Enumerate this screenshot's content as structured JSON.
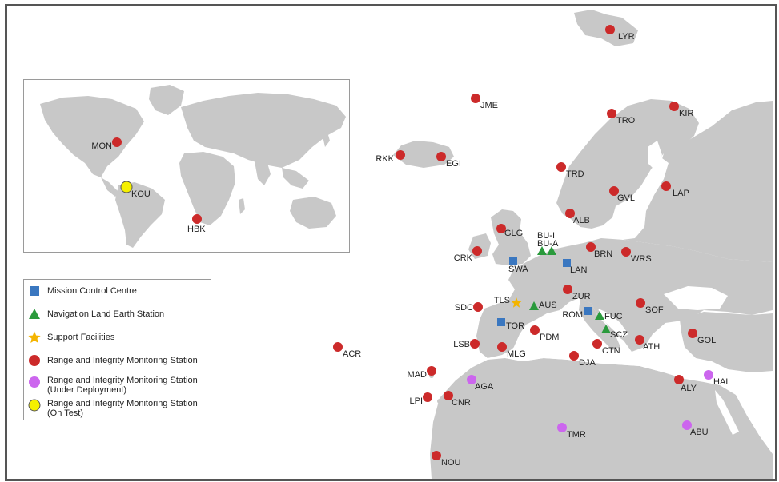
{
  "colors": {
    "land": "#c8c8c8",
    "sea": "#ffffff",
    "frame": "#555555",
    "mcc": "#3a77c0",
    "nles": "#2a9a3c",
    "support": "#f4b400",
    "rims": "#cc2a2a",
    "rims_deploy": "#cc66ee",
    "rims_test": "#f5f000"
  },
  "legend": [
    {
      "id": "mcc",
      "label": "Mission Control Centre",
      "symbol": "square",
      "color": "#3a77c0"
    },
    {
      "id": "nles",
      "label": "Navigation Land Earth Station",
      "symbol": "triangle",
      "color": "#2a9a3c"
    },
    {
      "id": "support",
      "label": "Support Facilities",
      "symbol": "star",
      "color": "#f4b400"
    },
    {
      "id": "rims",
      "label": "Range and Integrity Monitoring Station",
      "symbol": "circle",
      "color": "#cc2a2a"
    },
    {
      "id": "rims_deploy",
      "label": "Range and Integrity Monitoring Station",
      "sublabel": "(Under Deployment)",
      "symbol": "circle",
      "color": "#cc66ee"
    },
    {
      "id": "rims_test",
      "label": "Range and Integrity Monitoring Station",
      "sublabel": "(On Test)",
      "symbol": "circle",
      "color": "#f5f000"
    }
  ],
  "inset_stations": [
    {
      "name": "MON",
      "type": "rims"
    },
    {
      "name": "KOU",
      "type": "rims_test"
    },
    {
      "name": "HBK",
      "type": "rims"
    }
  ],
  "stations": [
    {
      "name": "LYR",
      "type": "rims"
    },
    {
      "name": "JME",
      "type": "rims"
    },
    {
      "name": "TRO",
      "type": "rims"
    },
    {
      "name": "KIR",
      "type": "rims"
    },
    {
      "name": "RKK",
      "type": "rims"
    },
    {
      "name": "EGI",
      "type": "rims"
    },
    {
      "name": "TRD",
      "type": "rims"
    },
    {
      "name": "GVL",
      "type": "rims"
    },
    {
      "name": "LAP",
      "type": "rims"
    },
    {
      "name": "ALB",
      "type": "rims"
    },
    {
      "name": "GLG",
      "type": "rims"
    },
    {
      "name": "BU-I",
      "type": "nles"
    },
    {
      "name": "BU-A",
      "type": "nles"
    },
    {
      "name": "BRN",
      "type": "rims"
    },
    {
      "name": "WRS",
      "type": "rims"
    },
    {
      "name": "CRK",
      "type": "rims"
    },
    {
      "name": "SWA",
      "type": "mcc"
    },
    {
      "name": "LAN",
      "type": "mcc"
    },
    {
      "name": "ZUR",
      "type": "rims"
    },
    {
      "name": "TLS",
      "type": "support"
    },
    {
      "name": "AUS",
      "type": "nles"
    },
    {
      "name": "SDC",
      "type": "rims"
    },
    {
      "name": "ROM",
      "type": "mcc"
    },
    {
      "name": "FUC",
      "type": "nles"
    },
    {
      "name": "SOF",
      "type": "rims"
    },
    {
      "name": "TOR",
      "type": "mcc"
    },
    {
      "name": "SCZ",
      "type": "nles"
    },
    {
      "name": "PDM",
      "type": "rims"
    },
    {
      "name": "LSB",
      "type": "rims"
    },
    {
      "name": "MLG",
      "type": "rims"
    },
    {
      "name": "CTN",
      "type": "rims"
    },
    {
      "name": "ATH",
      "type": "rims"
    },
    {
      "name": "GOL",
      "type": "rims"
    },
    {
      "name": "ACR",
      "type": "rims"
    },
    {
      "name": "DJA",
      "type": "rims"
    },
    {
      "name": "MAD",
      "type": "rims"
    },
    {
      "name": "AGA",
      "type": "rims_deploy"
    },
    {
      "name": "HAI",
      "type": "rims_deploy"
    },
    {
      "name": "ALY",
      "type": "rims"
    },
    {
      "name": "LPI",
      "type": "rims"
    },
    {
      "name": "CNR",
      "type": "rims"
    },
    {
      "name": "TMR",
      "type": "rims_deploy"
    },
    {
      "name": "ABU",
      "type": "rims_deploy"
    },
    {
      "name": "NOU",
      "type": "rims"
    }
  ]
}
